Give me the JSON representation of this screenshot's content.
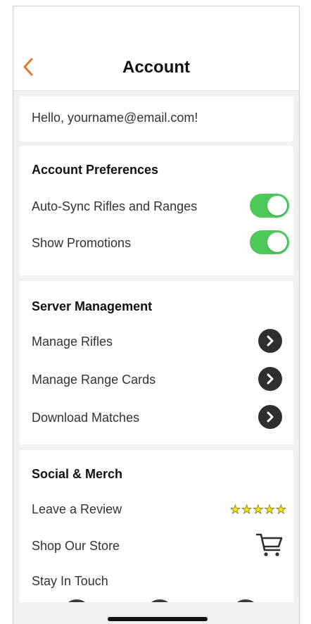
{
  "nav": {
    "title": "Account",
    "back_icon": "chevron-left-icon",
    "accent": "#e8772e"
  },
  "greeting": "Hello, yourname@email.com!",
  "account_preferences": {
    "title": "Account Preferences",
    "items": [
      {
        "label": "Auto-Sync Rifles and Ranges",
        "enabled": true
      },
      {
        "label": "Show Promotions",
        "enabled": true
      }
    ],
    "toggle_color": "#4cc95a"
  },
  "server_management": {
    "title": "Server Management",
    "items": [
      {
        "label": "Manage Rifles",
        "icon": "chevron-right-circle-icon"
      },
      {
        "label": "Manage Range Cards",
        "icon": "chevron-right-circle-icon"
      },
      {
        "label": "Download Matches",
        "icon": "chevron-right-circle-icon"
      }
    ]
  },
  "social_merch": {
    "title": "Social & Merch",
    "items": [
      {
        "label": "Leave a Review",
        "icon": "five-stars-icon"
      },
      {
        "label": "Shop Our Store",
        "icon": "shopping-cart-icon"
      },
      {
        "label": "Stay In Touch"
      }
    ]
  }
}
